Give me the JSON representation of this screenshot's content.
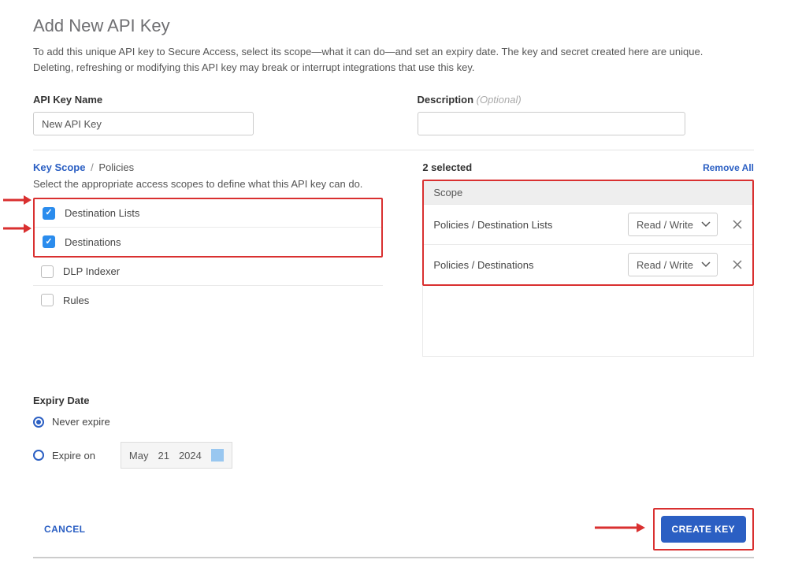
{
  "heading": "Add New API Key",
  "intro": "To add this unique API key to Secure Access, select its scope—what it can do—and set an expiry date. The key and secret created here are unique. Deleting, refreshing or modifying this API key may break or interrupt integrations that use this key.",
  "name_field": {
    "label": "API Key Name",
    "value": "New API Key"
  },
  "desc_field": {
    "label": "Description",
    "optional": "(Optional)",
    "value": ""
  },
  "scope": {
    "crumb_link": "Key Scope",
    "crumb_sep": "/",
    "crumb_current": "Policies",
    "desc": "Select the appropriate access scopes to define what this API key can do.",
    "items": [
      {
        "label": "Destination Lists",
        "checked": true
      },
      {
        "label": "Destinations",
        "checked": true
      },
      {
        "label": "DLP Indexer",
        "checked": false
      },
      {
        "label": "Rules",
        "checked": false
      }
    ]
  },
  "selected": {
    "count_label": "2 selected",
    "remove_all": "Remove All",
    "header": "Scope",
    "rows": [
      {
        "label": "Policies / Destination Lists",
        "perm": "Read / Write"
      },
      {
        "label": "Policies / Destinations",
        "perm": "Read / Write"
      }
    ]
  },
  "expiry": {
    "label": "Expiry Date",
    "never": "Never expire",
    "on": "Expire on",
    "date_month": "May",
    "date_day": "21",
    "date_year": "2024",
    "selected": "never"
  },
  "footer": {
    "cancel": "CANCEL",
    "create": "CREATE KEY"
  }
}
